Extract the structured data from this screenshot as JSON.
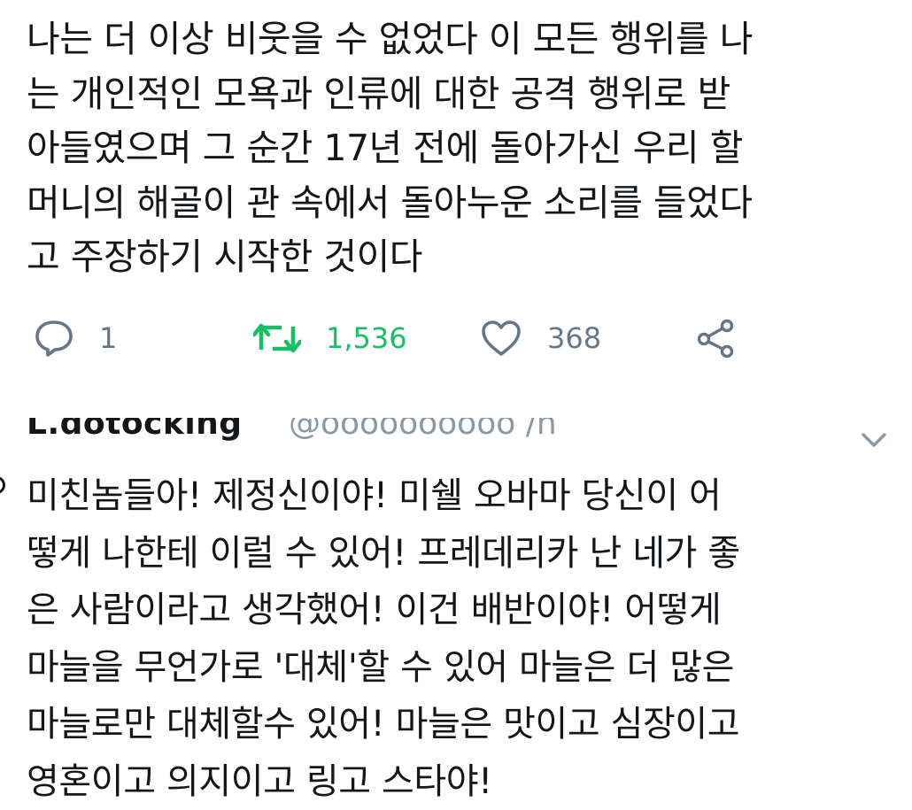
{
  "tweet": {
    "text": "나는 더 이상 비웃을 수 없었다 이 모든 행위를 나\n는 개인적인 모욕과 인류에 대한 공격 행위로 받\n아들였으며 그 순간 17년 전에 돌아가신 우리 할\n머니의 해골이 관 속에서 돌아누운 소리를 들었다\n고 주장하기 시작한 것이다",
    "reply_count": "1",
    "retweet_count": "1,536",
    "like_count": "368"
  },
  "next_tweet": {
    "display_name": "L.dotocking",
    "handle": "@oooooooooo  /h",
    "text": "미친놈들아! 제정신이야! 미쉘 오바마 당신이 어\n떻게 나한테 이럴 수 있어! 프레데리카 난 네가 좋\n은 사람이라고 생각했어! 이건 배반이야! 어떻게\n마늘을 무언가로 '대체'할 수 있어 마늘은 더 많은\n마늘로만 대체할수 있어! 마늘은 맛이고 심장이고\n영혼이고 의지이고 링고 스타야!"
  },
  "colors": {
    "text": "#14171a",
    "muted": "#657786",
    "retweet_active": "#17bf63",
    "background": "#ffffff"
  },
  "icons": {
    "reply": "speech-bubble-icon",
    "retweet": "retweet-arrows-icon",
    "like": "heart-icon",
    "share": "share-icon",
    "menu": "chevron-down-icon"
  }
}
